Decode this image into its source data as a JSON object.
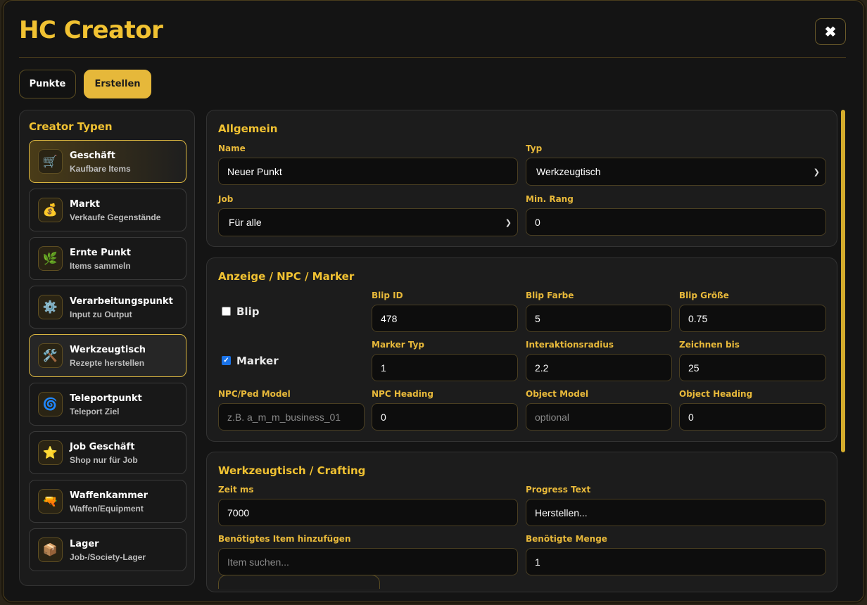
{
  "app": {
    "title": "HC Creator",
    "close_label": "✖"
  },
  "tabs": [
    {
      "label": "Punkte",
      "active": false
    },
    {
      "label": "Erstellen",
      "active": true
    }
  ],
  "sidebar": {
    "title": "Creator Typen",
    "items": [
      {
        "name": "Geschäft",
        "desc": "Kaufbare Items",
        "icon": "🛒",
        "icon_name": "cart-icon"
      },
      {
        "name": "Markt",
        "desc": "Verkaufe Gegenstände",
        "icon": "💰",
        "icon_name": "money-bag-icon"
      },
      {
        "name": "Ernte Punkt",
        "desc": "Items sammeln",
        "icon": "🌿",
        "icon_name": "herb-icon"
      },
      {
        "name": "Verarbeitungspunkt",
        "desc": "Input zu Output",
        "icon": "⚙️",
        "icon_name": "gear-icon"
      },
      {
        "name": "Werkzeugtisch",
        "desc": "Rezepte herstellen",
        "icon": "🛠️",
        "icon_name": "tools-icon"
      },
      {
        "name": "Teleportpunkt",
        "desc": "Teleport Ziel",
        "icon": "🌀",
        "icon_name": "portal-icon"
      },
      {
        "name": "Job Geschäft",
        "desc": "Shop nur für Job",
        "icon": "⭐",
        "icon_name": "star-icon"
      },
      {
        "name": "Waffenkammer",
        "desc": "Waffen/Equipment",
        "icon": "🔫",
        "icon_name": "weapon-icon"
      },
      {
        "name": "Lager",
        "desc": "Job-/Society-Lager",
        "icon": "📦",
        "icon_name": "package-icon"
      }
    ]
  },
  "allgemein": {
    "title": "Allgemein",
    "name_label": "Name",
    "name_value": "Neuer Punkt",
    "typ_label": "Typ",
    "typ_value": "Werkzeugtisch",
    "job_label": "Job",
    "job_value": "Für alle",
    "rang_label": "Min. Rang",
    "rang_value": "0"
  },
  "anzeige": {
    "title": "Anzeige / NPC / Marker",
    "blip_label": "Blip",
    "blip_checked": false,
    "marker_label": "Marker",
    "marker_checked": true,
    "blip_id_label": "Blip ID",
    "blip_id_value": "478",
    "blip_farbe_label": "Blip Farbe",
    "blip_farbe_value": "5",
    "blip_groesse_label": "Blip Größe",
    "blip_groesse_value": "0.75",
    "marker_typ_label": "Marker Typ",
    "marker_typ_value": "1",
    "radius_label": "Interaktionsradius",
    "radius_value": "2.2",
    "zeichnen_label": "Zeichnen bis",
    "zeichnen_value": "25",
    "npc_model_label": "NPC/Ped Model",
    "npc_model_placeholder": "z.B. a_m_m_business_01",
    "npc_heading_label": "NPC Heading",
    "npc_heading_value": "0",
    "object_model_label": "Object Model",
    "object_model_placeholder": "optional",
    "object_heading_label": "Object Heading",
    "object_heading_value": "0"
  },
  "crafting": {
    "title": "Werkzeugtisch / Crafting",
    "zeit_label": "Zeit ms",
    "zeit_value": "7000",
    "progress_label": "Progress Text",
    "progress_value": "Herstellen...",
    "item_label": "Benötigtes Item hinzufügen",
    "item_placeholder": "Item suchen...",
    "menge_label": "Benötigte Menge",
    "menge_value": "1"
  },
  "colors": {
    "accent": "#f1c232",
    "background": "#141414",
    "checkbox_checked": "#1a73e8"
  }
}
